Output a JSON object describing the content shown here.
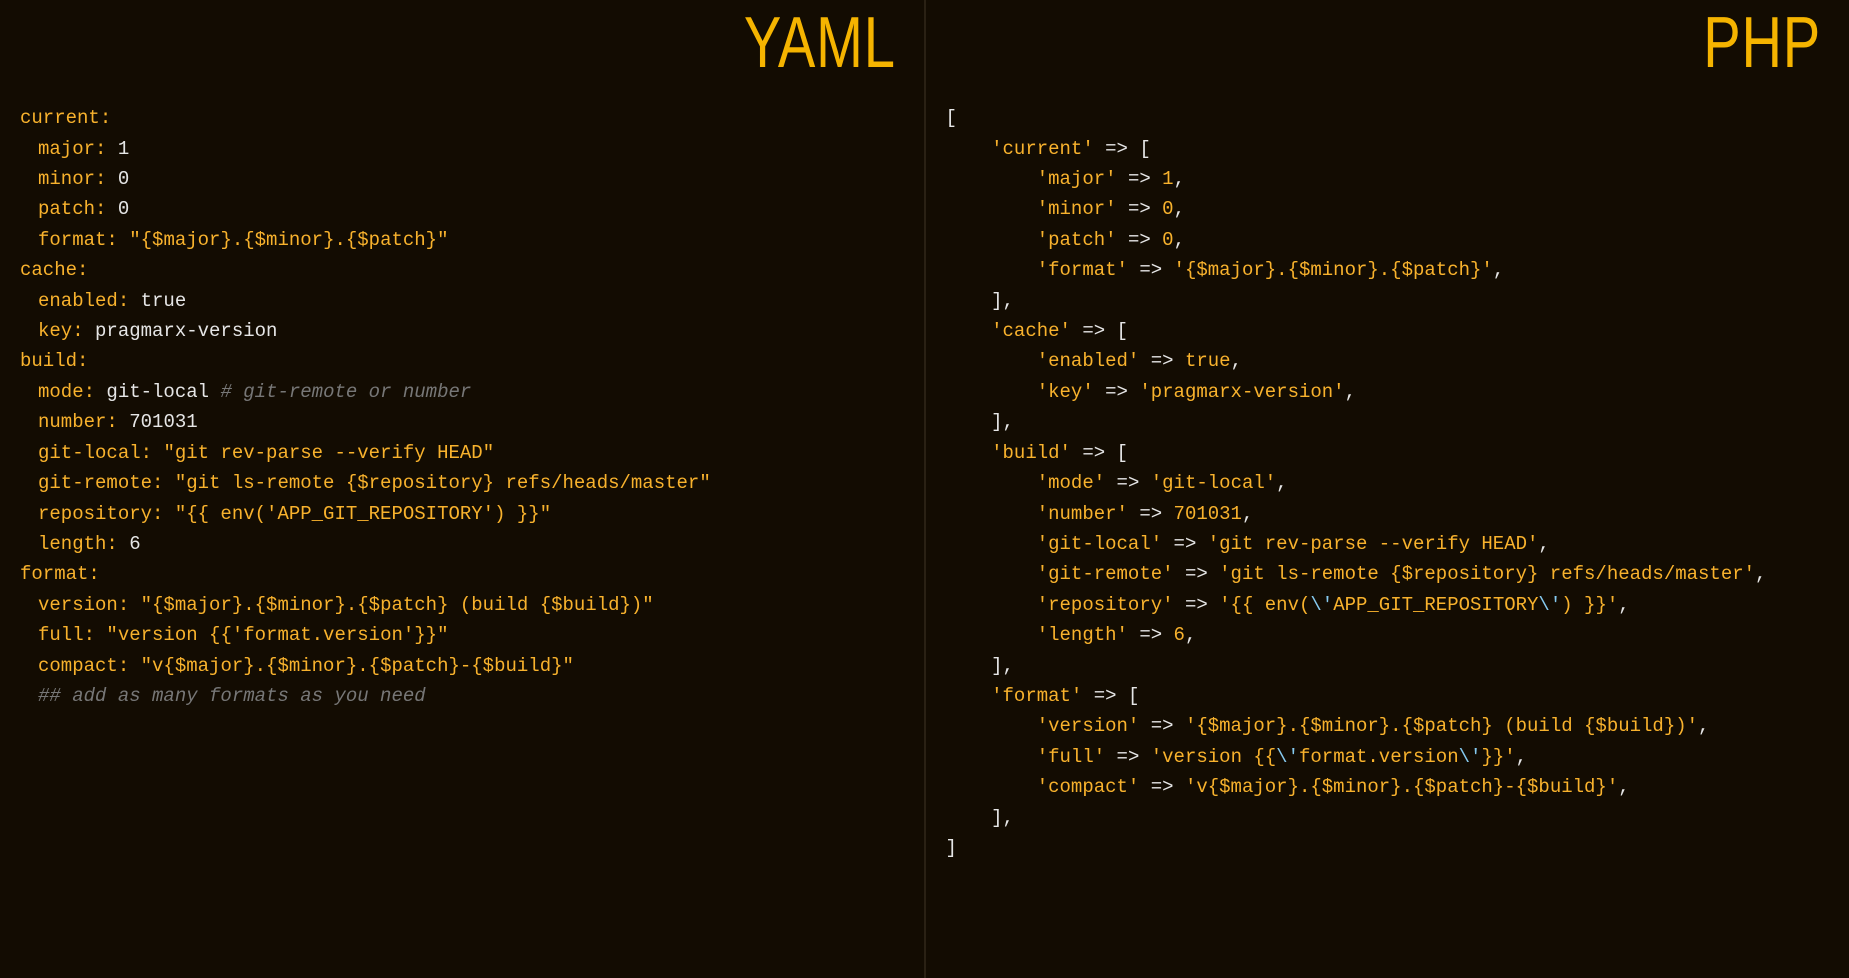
{
  "left": {
    "badge": "YAML",
    "lines": [
      [
        {
          "c": "k",
          "t": "current:"
        }
      ],
      [
        {
          "c": "bar",
          "t": ""
        },
        {
          "c": "k",
          "t": "major:"
        },
        {
          "c": "pu",
          "t": " "
        },
        {
          "c": "n",
          "t": "1"
        }
      ],
      [
        {
          "c": "bar",
          "t": ""
        },
        {
          "c": "k",
          "t": "minor:"
        },
        {
          "c": "pu",
          "t": " "
        },
        {
          "c": "n",
          "t": "0"
        }
      ],
      [
        {
          "c": "bar",
          "t": ""
        },
        {
          "c": "k",
          "t": "patch:"
        },
        {
          "c": "pu",
          "t": " "
        },
        {
          "c": "n",
          "t": "0"
        }
      ],
      [
        {
          "c": "bar",
          "t": ""
        },
        {
          "c": "k",
          "t": "format:"
        },
        {
          "c": "pu",
          "t": " "
        },
        {
          "c": "s",
          "t": "\"{$major}.{$minor}.{$patch}\""
        }
      ],
      [
        {
          "c": "k",
          "t": "cache:"
        }
      ],
      [
        {
          "c": "bar",
          "t": ""
        },
        {
          "c": "k",
          "t": "enabled:"
        },
        {
          "c": "pu",
          "t": " "
        },
        {
          "c": "n",
          "t": "true"
        }
      ],
      [
        {
          "c": "bar",
          "t": ""
        },
        {
          "c": "k",
          "t": "key:"
        },
        {
          "c": "pu",
          "t": " "
        },
        {
          "c": "w",
          "t": "pragmarx-version"
        }
      ],
      [
        {
          "c": "k",
          "t": "build:"
        }
      ],
      [
        {
          "c": "bar",
          "t": ""
        },
        {
          "c": "k",
          "t": "mode:"
        },
        {
          "c": "pu",
          "t": " "
        },
        {
          "c": "n",
          "t": "git-local"
        },
        {
          "c": "pu",
          "t": " "
        },
        {
          "c": "c",
          "t": "# git-remote or number"
        }
      ],
      [
        {
          "c": "bar",
          "t": ""
        },
        {
          "c": "k",
          "t": "number:"
        },
        {
          "c": "pu",
          "t": " "
        },
        {
          "c": "n",
          "t": "701031"
        }
      ],
      [
        {
          "c": "bar",
          "t": ""
        },
        {
          "c": "k",
          "t": "git-local:"
        },
        {
          "c": "pu",
          "t": " "
        },
        {
          "c": "s",
          "t": "\"git rev-parse --verify HEAD\""
        }
      ],
      [
        {
          "c": "bar",
          "t": ""
        },
        {
          "c": "k",
          "t": "git-remote:"
        },
        {
          "c": "pu",
          "t": " "
        },
        {
          "c": "s",
          "t": "\"git ls-remote {$repository} refs/heads/master\""
        }
      ],
      [
        {
          "c": "bar",
          "t": ""
        },
        {
          "c": "k",
          "t": "repository:"
        },
        {
          "c": "pu",
          "t": " "
        },
        {
          "c": "s",
          "t": "\"{{ env('APP_GIT_REPOSITORY') }}\""
        }
      ],
      [
        {
          "c": "bar",
          "t": ""
        },
        {
          "c": "k",
          "t": "length:"
        },
        {
          "c": "pu",
          "t": " "
        },
        {
          "c": "n",
          "t": "6"
        }
      ],
      [
        {
          "c": "k",
          "t": "format:"
        }
      ],
      [
        {
          "c": "bar",
          "t": ""
        },
        {
          "c": "k",
          "t": "version:"
        },
        {
          "c": "pu",
          "t": " "
        },
        {
          "c": "s",
          "t": "\"{$major}.{$minor}.{$patch} (build {$build})\""
        }
      ],
      [
        {
          "c": "bar",
          "t": ""
        },
        {
          "c": "k",
          "t": "full:"
        },
        {
          "c": "pu",
          "t": " "
        },
        {
          "c": "s",
          "t": "\"version {{'format.version'}}\""
        }
      ],
      [
        {
          "c": "bar",
          "t": ""
        },
        {
          "c": "k",
          "t": "compact:"
        },
        {
          "c": "pu",
          "t": " "
        },
        {
          "c": "s",
          "t": "\"v{$major}.{$minor}.{$patch}-{$build}\""
        }
      ],
      [
        {
          "c": "bar",
          "t": ""
        },
        {
          "c": "c",
          "t": "## add as many formats as you need"
        }
      ]
    ]
  },
  "right": {
    "badge": "PHP",
    "lines": [
      [
        {
          "c": "pu",
          "t": "["
        }
      ],
      [
        {
          "c": "pu",
          "t": "    "
        },
        {
          "c": "s",
          "t": "'current'"
        },
        {
          "c": "op",
          "t": " => "
        },
        {
          "c": "pu",
          "t": "["
        }
      ],
      [
        {
          "c": "pu",
          "t": "        "
        },
        {
          "c": "s",
          "t": "'major'"
        },
        {
          "c": "op",
          "t": " => "
        },
        {
          "c": "s",
          "t": "1"
        },
        {
          "c": "pu",
          "t": ","
        }
      ],
      [
        {
          "c": "pu",
          "t": "        "
        },
        {
          "c": "s",
          "t": "'minor'"
        },
        {
          "c": "op",
          "t": " => "
        },
        {
          "c": "s",
          "t": "0"
        },
        {
          "c": "pu",
          "t": ","
        }
      ],
      [
        {
          "c": "pu",
          "t": "        "
        },
        {
          "c": "s",
          "t": "'patch'"
        },
        {
          "c": "op",
          "t": " => "
        },
        {
          "c": "s",
          "t": "0"
        },
        {
          "c": "pu",
          "t": ","
        }
      ],
      [
        {
          "c": "pu",
          "t": "        "
        },
        {
          "c": "s",
          "t": "'format'"
        },
        {
          "c": "op",
          "t": " => "
        },
        {
          "c": "s",
          "t": "'{$major}.{$minor}.{$patch}'"
        },
        {
          "c": "pu",
          "t": ","
        }
      ],
      [
        {
          "c": "pu",
          "t": "    ],"
        }
      ],
      [
        {
          "c": "pu",
          "t": "    "
        },
        {
          "c": "s",
          "t": "'cache'"
        },
        {
          "c": "op",
          "t": " => "
        },
        {
          "c": "pu",
          "t": "["
        }
      ],
      [
        {
          "c": "pu",
          "t": "        "
        },
        {
          "c": "s",
          "t": "'enabled'"
        },
        {
          "c": "op",
          "t": " => "
        },
        {
          "c": "s",
          "t": "true"
        },
        {
          "c": "pu",
          "t": ","
        }
      ],
      [
        {
          "c": "pu",
          "t": "        "
        },
        {
          "c": "s",
          "t": "'key'"
        },
        {
          "c": "op",
          "t": " => "
        },
        {
          "c": "s",
          "t": "'pragmarx-version'"
        },
        {
          "c": "pu",
          "t": ","
        }
      ],
      [
        {
          "c": "pu",
          "t": "    ],"
        }
      ],
      [
        {
          "c": "pu",
          "t": "    "
        },
        {
          "c": "s",
          "t": "'build'"
        },
        {
          "c": "op",
          "t": " => "
        },
        {
          "c": "pu",
          "t": "["
        }
      ],
      [
        {
          "c": "pu",
          "t": "        "
        },
        {
          "c": "s",
          "t": "'mode'"
        },
        {
          "c": "op",
          "t": " => "
        },
        {
          "c": "s",
          "t": "'git-local'"
        },
        {
          "c": "pu",
          "t": ","
        }
      ],
      [
        {
          "c": "pu",
          "t": "        "
        },
        {
          "c": "s",
          "t": "'number'"
        },
        {
          "c": "op",
          "t": " => "
        },
        {
          "c": "s",
          "t": "701031"
        },
        {
          "c": "pu",
          "t": ","
        }
      ],
      [
        {
          "c": "pu",
          "t": "        "
        },
        {
          "c": "s",
          "t": "'git-local'"
        },
        {
          "c": "op",
          "t": " => "
        },
        {
          "c": "s",
          "t": "'git rev-parse --verify HEAD'"
        },
        {
          "c": "pu",
          "t": ","
        }
      ],
      [
        {
          "c": "pu",
          "t": "        "
        },
        {
          "c": "s",
          "t": "'git-remote'"
        },
        {
          "c": "op",
          "t": " => "
        },
        {
          "c": "s",
          "t": "'git ls-remote {$repository} refs/heads/master'"
        },
        {
          "c": "pu",
          "t": ","
        }
      ],
      [
        {
          "c": "pu",
          "t": "        "
        },
        {
          "c": "s",
          "t": "'repository'"
        },
        {
          "c": "op",
          "t": " => "
        },
        {
          "c": "s",
          "t": "'{{ env("
        },
        {
          "c": "esc",
          "t": "\\'"
        },
        {
          "c": "s",
          "t": "APP_GIT_REPOSITORY"
        },
        {
          "c": "esc",
          "t": "\\'"
        },
        {
          "c": "s",
          "t": ") }}'"
        },
        {
          "c": "pu",
          "t": ","
        }
      ],
      [
        {
          "c": "pu",
          "t": "        "
        },
        {
          "c": "s",
          "t": "'length'"
        },
        {
          "c": "op",
          "t": " => "
        },
        {
          "c": "s",
          "t": "6"
        },
        {
          "c": "pu",
          "t": ","
        }
      ],
      [
        {
          "c": "pu",
          "t": "    ],"
        }
      ],
      [
        {
          "c": "pu",
          "t": "    "
        },
        {
          "c": "s",
          "t": "'format'"
        },
        {
          "c": "op",
          "t": " => "
        },
        {
          "c": "pu",
          "t": "["
        }
      ],
      [
        {
          "c": "pu",
          "t": "        "
        },
        {
          "c": "s",
          "t": "'version'"
        },
        {
          "c": "op",
          "t": " => "
        },
        {
          "c": "s",
          "t": "'{$major}.{$minor}.{$patch} (build {$build})'"
        },
        {
          "c": "pu",
          "t": ","
        }
      ],
      [
        {
          "c": "pu",
          "t": "        "
        },
        {
          "c": "s",
          "t": "'full'"
        },
        {
          "c": "op",
          "t": " => "
        },
        {
          "c": "s",
          "t": "'version {{"
        },
        {
          "c": "esc",
          "t": "\\'"
        },
        {
          "c": "s",
          "t": "format.version"
        },
        {
          "c": "esc",
          "t": "\\'"
        },
        {
          "c": "s",
          "t": "}}'"
        },
        {
          "c": "pu",
          "t": ","
        }
      ],
      [
        {
          "c": "pu",
          "t": "        "
        },
        {
          "c": "s",
          "t": "'compact'"
        },
        {
          "c": "op",
          "t": " => "
        },
        {
          "c": "s",
          "t": "'v{$major}.{$minor}.{$patch}-{$build}'"
        },
        {
          "c": "pu",
          "t": ","
        }
      ],
      [
        {
          "c": "pu",
          "t": "    ],"
        }
      ],
      [
        {
          "c": "pu",
          "t": "]"
        }
      ]
    ]
  }
}
